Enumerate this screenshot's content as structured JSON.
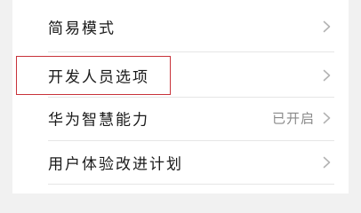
{
  "settings": {
    "items": [
      {
        "label": "简易模式",
        "value": ""
      },
      {
        "label": "开发人员选项",
        "value": ""
      },
      {
        "label": "华为智慧能力",
        "value": "已开启"
      },
      {
        "label": "用户体验改进计划",
        "value": ""
      }
    ]
  },
  "highlight_color": "#c8323a",
  "icons": {
    "chevron": "chevron-right-icon"
  }
}
